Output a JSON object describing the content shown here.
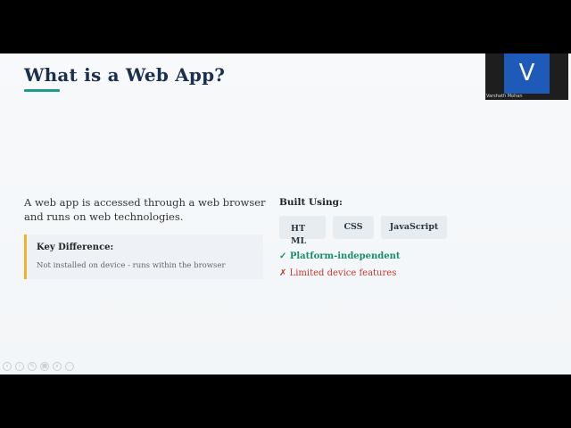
{
  "slide": {
    "title": "What is a Web App?",
    "description": "A web app is accessed through a web browser and runs on web technologies.",
    "callout": {
      "title": "Key Difference:",
      "text": "Not installed on device - runs within the browser"
    },
    "built_using": {
      "heading": "Built Using:",
      "chips": [
        "HTML",
        "CSS",
        "JavaScript"
      ]
    },
    "pro": "✓ Platform-independent",
    "con": "✗ Limited device features",
    "accent_color": "#1a9c8c",
    "callout_border_color": "#f0b429",
    "pro_color": "#1a8c6e",
    "con_color": "#c0392b"
  },
  "presentation_controls": {
    "icons": [
      "previous-icon",
      "next-icon",
      "pen-icon",
      "slides-icon",
      "zoom-icon",
      "more-icon"
    ]
  },
  "participant": {
    "initial": "V",
    "name": "Varshath Mohan",
    "avatar_color": "#1e5bb8"
  }
}
